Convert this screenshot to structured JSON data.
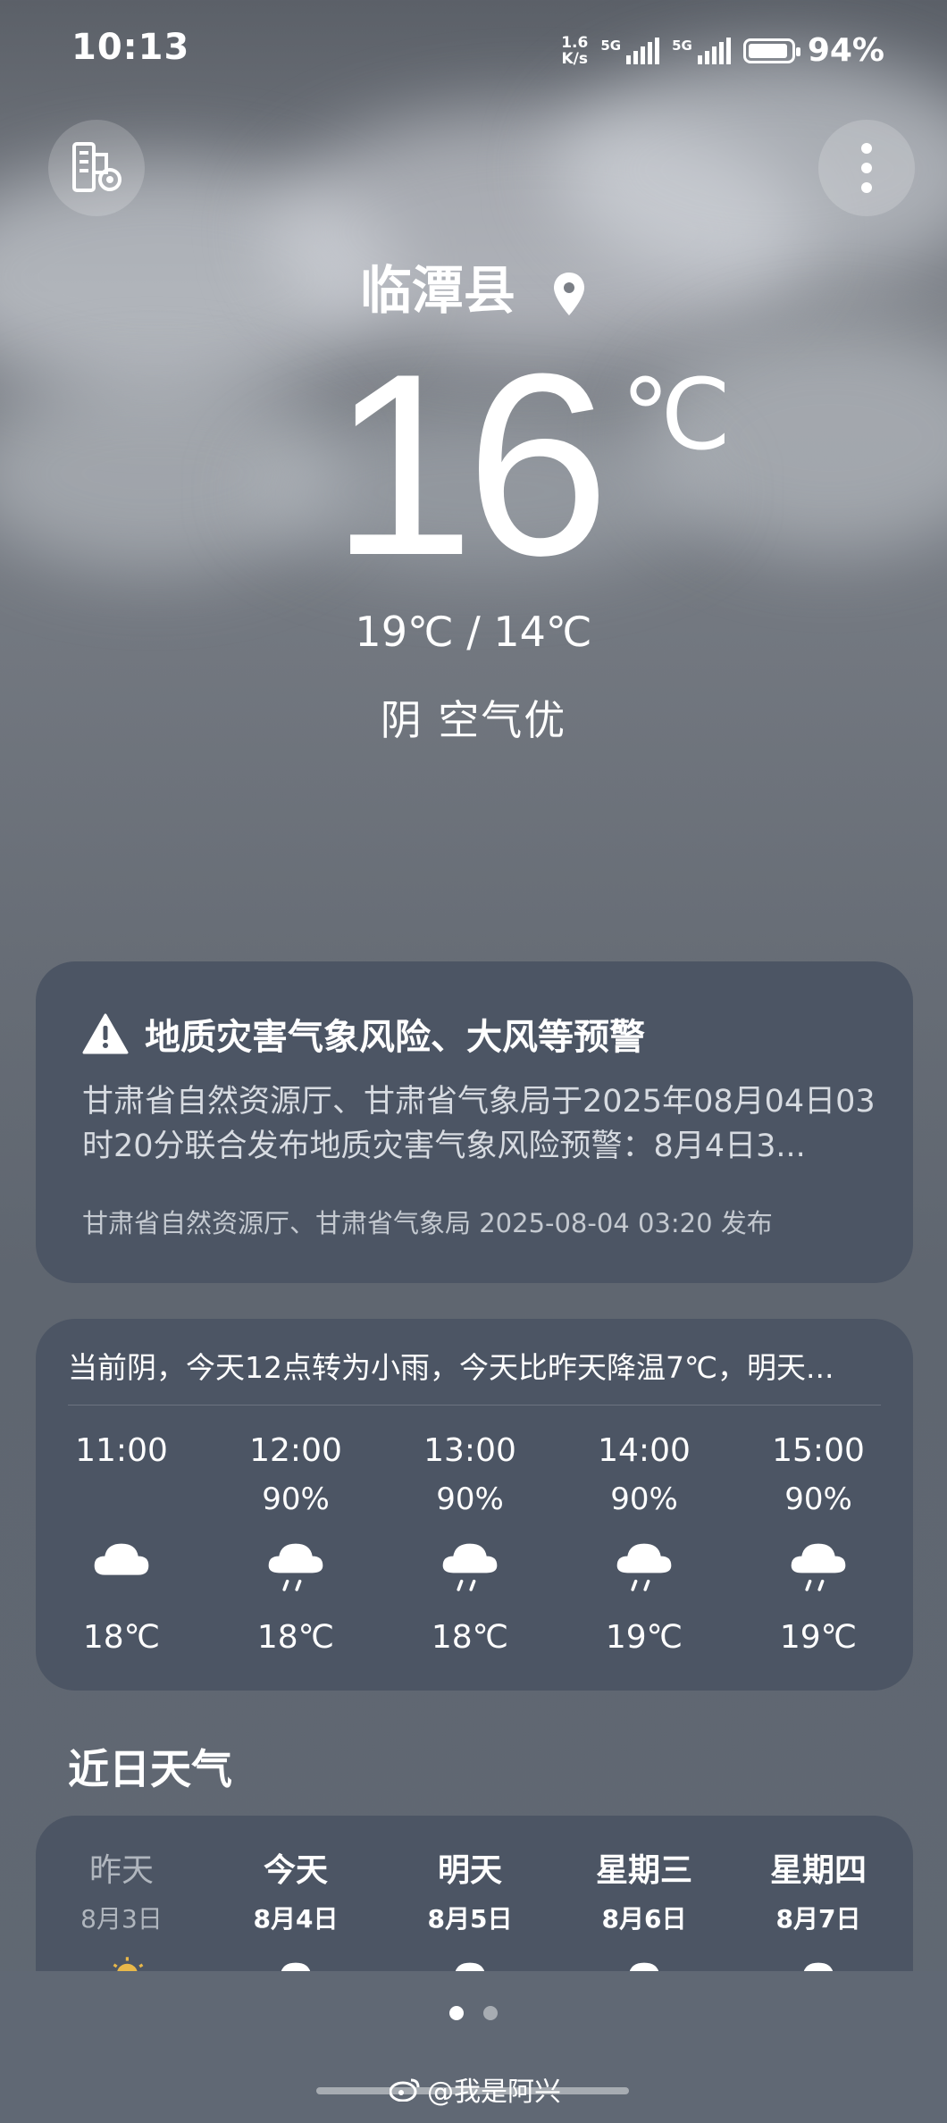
{
  "status_bar": {
    "time": "10:13",
    "net_speed_top": "1.6",
    "net_speed_bottom": "K/s",
    "signal1": "5G",
    "signal2": "5G",
    "battery_pct": "94%",
    "battery_level": 0.94
  },
  "location": {
    "city": "临潭县"
  },
  "current": {
    "temp": "16",
    "unit": "℃",
    "range": "19℃ / 14℃",
    "condition": "阴  空气优"
  },
  "alert": {
    "title": "地质灾害气象风险、大风等预警",
    "body": "甘肃省自然资源厅、甘肃省气象局于2025年08月04日03时20分联合发布地质灾害气象风险预警：8月4日3...",
    "source": "甘肃省自然资源厅、甘肃省气象局 2025-08-04 03:20 发布"
  },
  "hourly": {
    "summary": "当前阴，今天12点转为小雨，今天比昨天降温7℃，明天...",
    "items": [
      {
        "time": "11:00",
        "precip": "",
        "icon": "cloudy-icon",
        "temp": "18℃"
      },
      {
        "time": "12:00",
        "precip": "90%",
        "icon": "light-rain-icon",
        "temp": "18℃"
      },
      {
        "time": "13:00",
        "precip": "90%",
        "icon": "light-rain-icon",
        "temp": "18℃"
      },
      {
        "time": "14:00",
        "precip": "90%",
        "icon": "light-rain-icon",
        "temp": "19℃"
      },
      {
        "time": "15:00",
        "precip": "90%",
        "icon": "light-rain-icon",
        "temp": "19℃"
      }
    ]
  },
  "daily": {
    "title": "近日天气",
    "items": [
      {
        "name": "昨天",
        "date": "8月3日",
        "icon": "partly-cloudy-icon"
      },
      {
        "name": "今天",
        "date": "8月4日",
        "icon": "cloudy-icon"
      },
      {
        "name": "明天",
        "date": "8月5日",
        "icon": "cloudy-icon"
      },
      {
        "name": "星期三",
        "date": "8月6日",
        "icon": "cloudy-icon"
      },
      {
        "name": "星期四",
        "date": "8月7日",
        "icon": "cloudy-icon"
      }
    ]
  },
  "pager": {
    "count": 2,
    "active": 0
  },
  "watermark": "@我是阿兴"
}
